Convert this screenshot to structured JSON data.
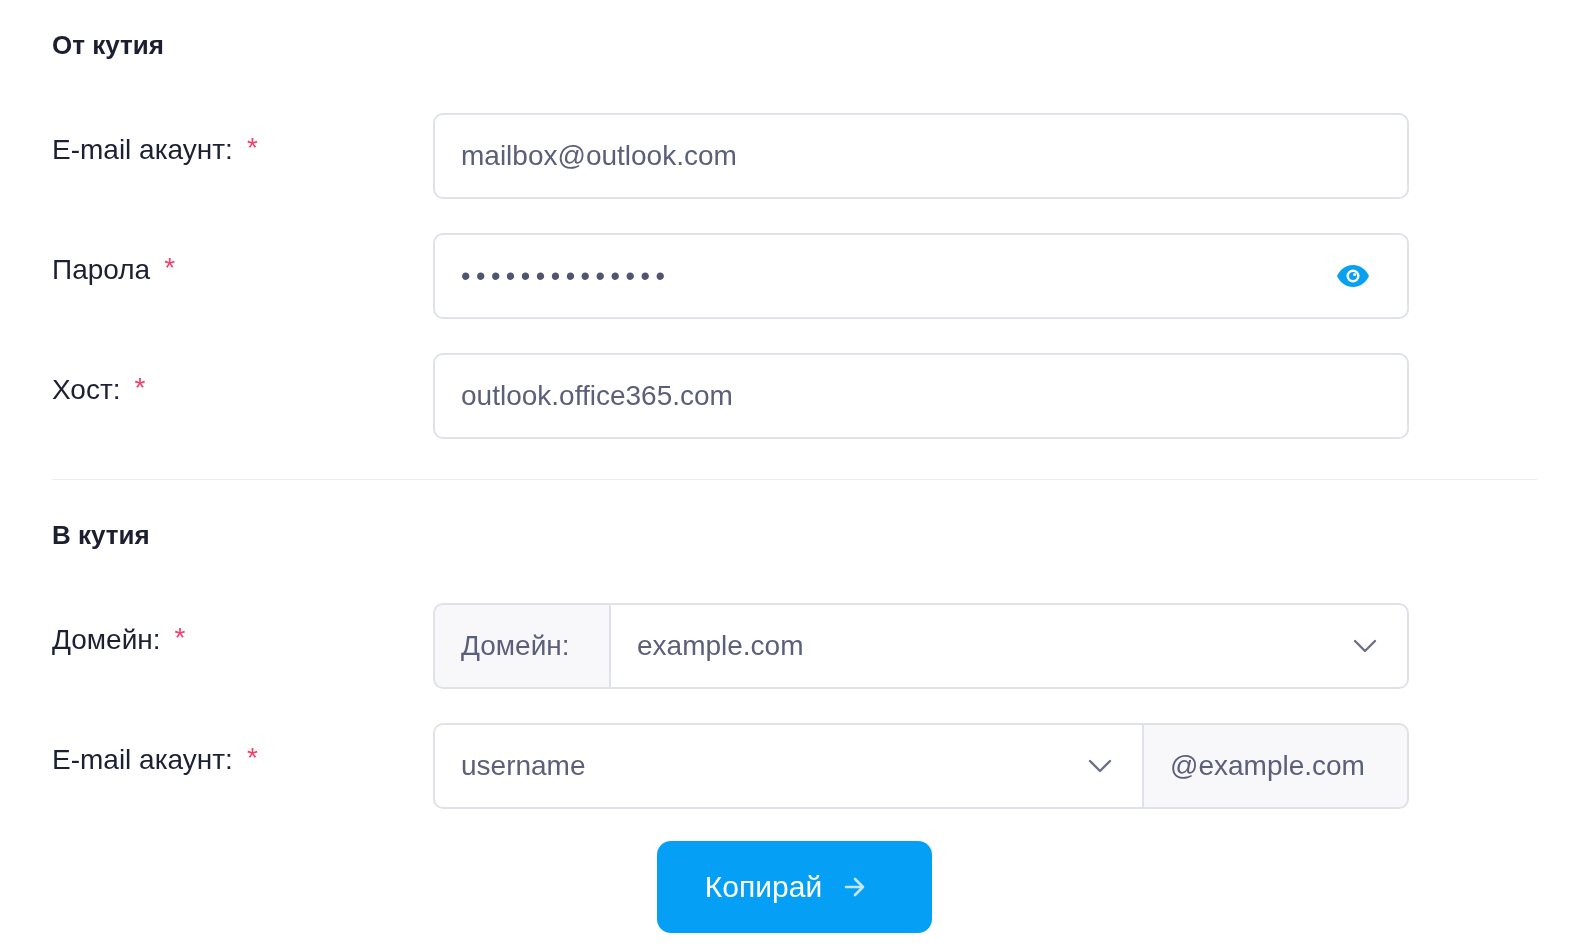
{
  "sections": [
    {
      "title": "От кутия",
      "fields": [
        {
          "kind": "text",
          "label": "E-mail акаунт:",
          "required_mark": "*",
          "value": "mailbox@outlook.com"
        },
        {
          "kind": "password",
          "label": "Парола",
          "required_mark": "*",
          "value": "••••••••••••••"
        },
        {
          "kind": "text",
          "label": "Хост:",
          "required_mark": "*",
          "value": "outlook.office365.com"
        }
      ]
    },
    {
      "title": "В кутия",
      "fields": [
        {
          "kind": "select_prefixed",
          "label": "Домейн:",
          "required_mark": "*",
          "prefix": "Домейн:",
          "value": "example.com"
        },
        {
          "kind": "select_suffixed",
          "label": "E-mail акаунт:",
          "required_mark": "*",
          "value": "username",
          "suffix": "@example.com"
        }
      ]
    }
  ],
  "submit": {
    "label": "Копирай"
  }
}
